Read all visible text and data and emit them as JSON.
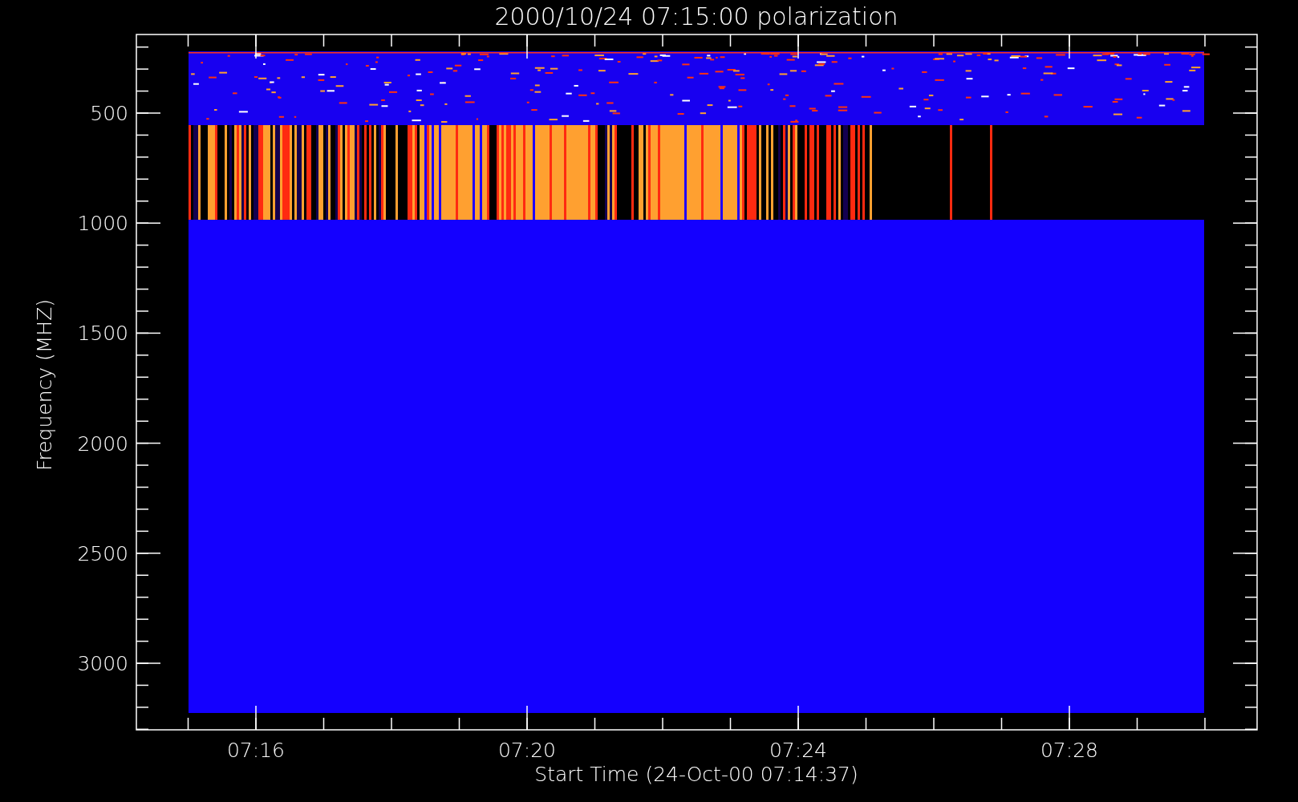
{
  "title": "2000/10/24 07:15:00 polarization",
  "y_axis": {
    "label": "Frequency (MHZ)",
    "tick_labels": [
      "500",
      "1000",
      "1500",
      "2000",
      "2500",
      "3000"
    ]
  },
  "x_axis": {
    "label": "Start Time (24-Oct-00 07:14:37)",
    "tick_labels": [
      "07:16",
      "07:20",
      "07:24",
      "07:28"
    ]
  }
}
